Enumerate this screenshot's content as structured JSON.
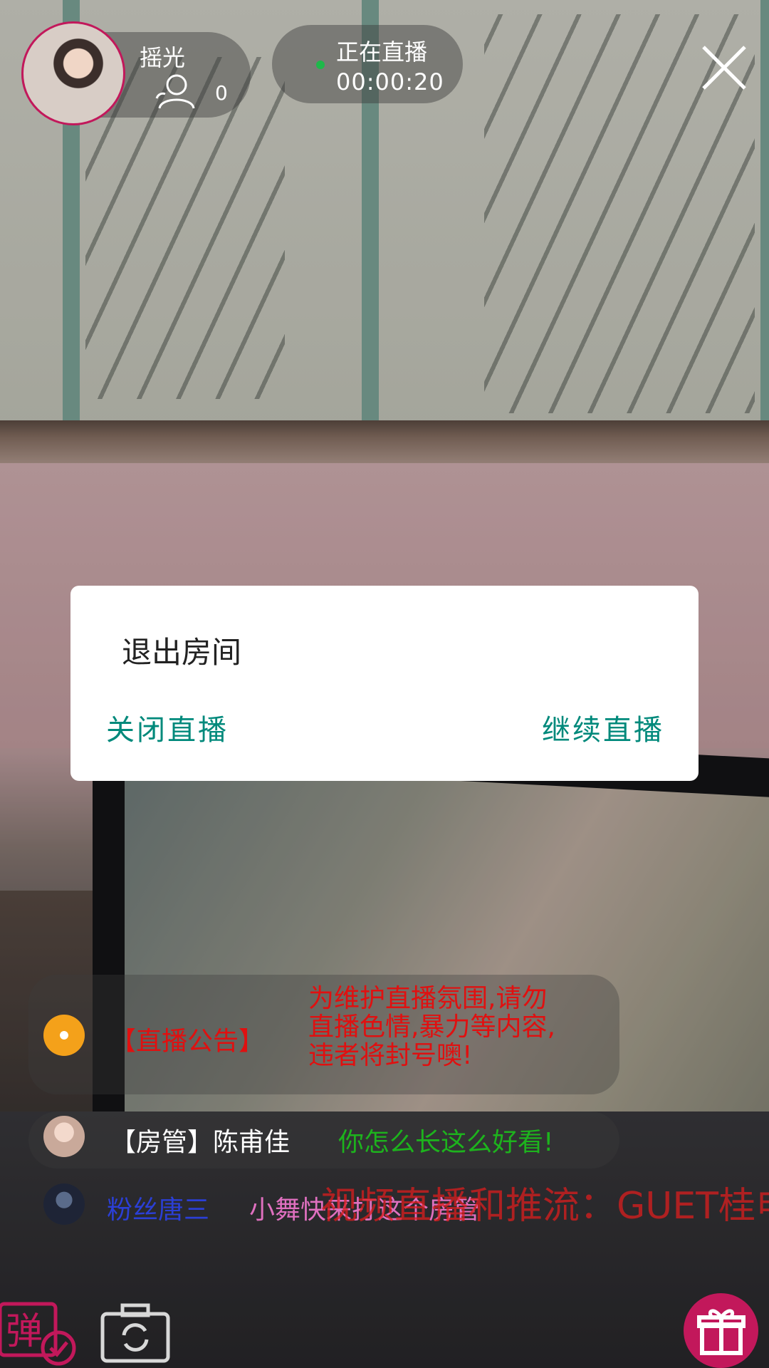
{
  "host": {
    "name": "摇光",
    "viewer_count": "0"
  },
  "live": {
    "status": "正在直播",
    "timer": "00:00:20"
  },
  "dialog": {
    "title": "退出房间",
    "close_live_label": "关闭直播",
    "continue_live_label": "继续直播"
  },
  "chat": {
    "notice": {
      "tag": "【直播公告】",
      "line1": "为维护直播氛围,请勿",
      "line2": "直播色情,暴力等内容,",
      "line3": "违者将封号噢!"
    },
    "messages": [
      {
        "sender": "【房管】陈甫佳",
        "text": "你怎么长这么好看!"
      },
      {
        "sender": "粉丝唐三",
        "text": "小舞快来打这个房管"
      }
    ]
  },
  "watermark": "视频直播和推流：GUET桂电",
  "controls": {
    "danmu_label": "弹"
  },
  "colors": {
    "accent": "#00897b",
    "brand": "#c2185b",
    "live_dot": "#1eb84a",
    "notice_red": "#e01010",
    "mod_message_green": "#1db31d",
    "fan_name_blue": "#2b3fd6",
    "fan_message_pink": "#e070c0"
  },
  "icons": {
    "viewer": "person-outline-icon",
    "close": "close-icon",
    "camera": "camera-switch-icon",
    "gift": "gift-icon",
    "danmu": "danmu-toggle-icon"
  }
}
